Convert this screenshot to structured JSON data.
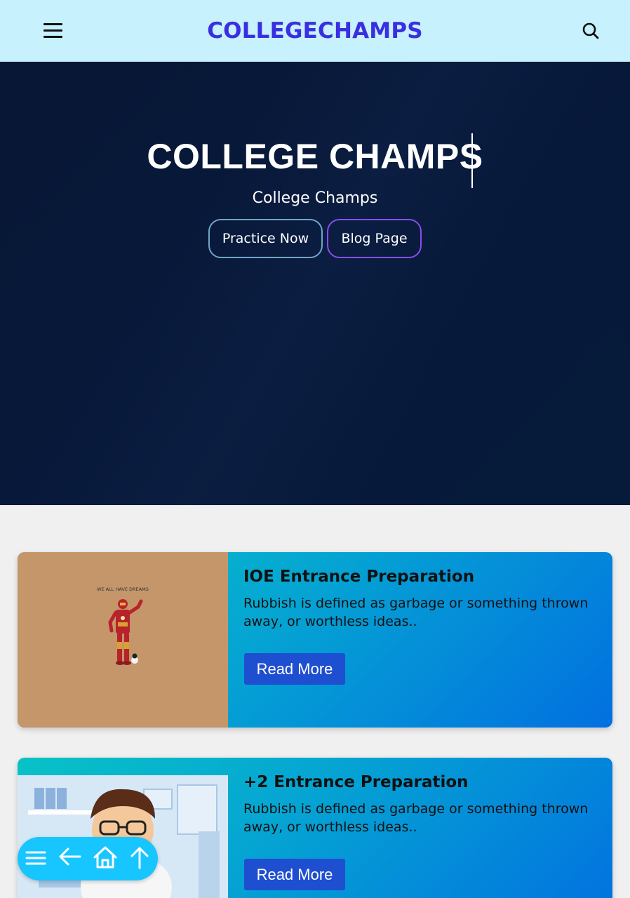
{
  "header": {
    "brand": "COLLEGECHAMPS",
    "menu_icon": "hamburger-menu-icon",
    "search_icon": "search-icon",
    "background": "#c6f1fd",
    "brand_color": "#3a2fe0"
  },
  "hero": {
    "title": "COLLEGE CHAMPS",
    "subtitle": "College Champs",
    "buttons": {
      "practice": "Practice Now",
      "blog": "Blog Page"
    },
    "background": "#07183a"
  },
  "cards": [
    {
      "title": "IOE Entrance Preparation",
      "text": "Rubbish is defined as garbage or something thrown away, or worthless ideas..",
      "button": "Read More",
      "image_caption": "WE ALL HAVE DREAMS"
    },
    {
      "title": "+2 Entrance Preparation",
      "text": "Rubbish is defined as garbage or something thrown away, or worthless ideas..",
      "button": "Read More"
    }
  ],
  "floating_nav": {
    "icons": [
      "menu-icon",
      "back-arrow-icon",
      "home-icon",
      "scroll-up-arrow-icon"
    ],
    "background": "#18c6ff"
  }
}
